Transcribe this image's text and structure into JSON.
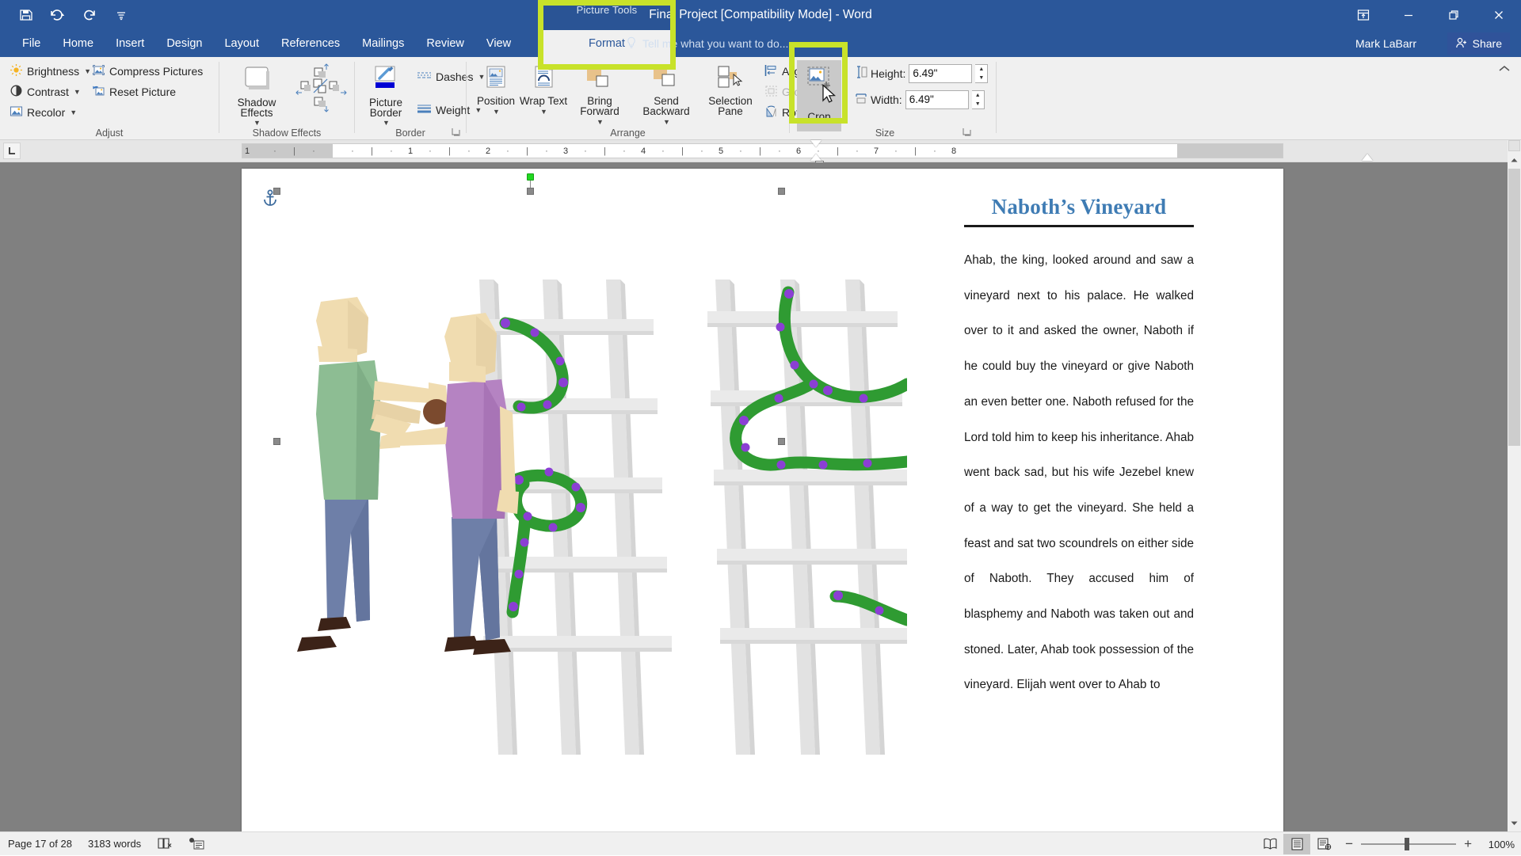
{
  "window": {
    "context_tab_label": "Picture Tools",
    "title": "Final Project [Compatibility Mode] - Word",
    "account_name": "Mark LaBarr",
    "share_label": "Share",
    "quick_access": [
      "save-icon",
      "undo-icon",
      "redo-icon",
      "customize-qat-icon"
    ],
    "window_buttons": [
      "ribbon-display-options-icon",
      "minimize-icon",
      "restore-icon",
      "close-icon"
    ]
  },
  "tabs": [
    {
      "label": "File",
      "active": false
    },
    {
      "label": "Home",
      "active": false
    },
    {
      "label": "Insert",
      "active": false
    },
    {
      "label": "Design",
      "active": false
    },
    {
      "label": "Layout",
      "active": false
    },
    {
      "label": "References",
      "active": false
    },
    {
      "label": "Mailings",
      "active": false
    },
    {
      "label": "Review",
      "active": false
    },
    {
      "label": "View",
      "active": false
    }
  ],
  "format_tab": {
    "label": "Format",
    "active": true,
    "highlighted": true
  },
  "tell_me": {
    "placeholder": "Tell me what you want to do...",
    "icon": "lightbulb-icon"
  },
  "ribbon": {
    "groups": [
      {
        "name": "Adjust",
        "label": "Adjust",
        "items": [
          {
            "label": "Brightness",
            "icon": "brightness-icon",
            "dropdown": true
          },
          {
            "label": "Contrast",
            "icon": "contrast-icon",
            "dropdown": true
          },
          {
            "label": "Recolor",
            "icon": "recolor-icon",
            "dropdown": true
          },
          {
            "label": "Compress Pictures",
            "icon": "compress-pictures-icon",
            "dropdown": false
          },
          {
            "label": "Reset Picture",
            "icon": "reset-picture-icon",
            "dropdown": false
          }
        ]
      },
      {
        "name": "Shadow Effects",
        "label": "Shadow Effects",
        "items": [
          {
            "label": "Shadow Effects",
            "icon": "shadow-effects-icon",
            "dropdown": true
          },
          {
            "label": "Nudge Shadow Up",
            "icon": "nudge-shadow-up-icon"
          },
          {
            "label": "Nudge Shadow Left",
            "icon": "nudge-shadow-left-icon"
          },
          {
            "label": "Nudge Shadow Right",
            "icon": "nudge-shadow-right-icon"
          },
          {
            "label": "Nudge Shadow Down",
            "icon": "nudge-shadow-down-icon"
          },
          {
            "label": "Shadow On Off",
            "icon": "shadow-toggle-icon"
          }
        ]
      },
      {
        "name": "Border",
        "label": "Border",
        "items": [
          {
            "label": "Picture Border",
            "icon": "picture-border-icon",
            "dropdown": true,
            "color": "#0000d4"
          },
          {
            "label": "Dashes",
            "icon": "dashes-icon",
            "dropdown": true
          },
          {
            "label": "Weight",
            "icon": "weight-icon",
            "dropdown": true
          }
        ],
        "has_dialog_launcher": true
      },
      {
        "name": "Arrange",
        "label": "Arrange",
        "items": [
          {
            "label": "Position",
            "icon": "position-icon",
            "dropdown": true
          },
          {
            "label": "Wrap Text",
            "icon": "wrap-text-icon",
            "dropdown": true
          },
          {
            "label": "Bring Forward",
            "icon": "bring-forward-icon",
            "dropdown": true
          },
          {
            "label": "Send Backward",
            "icon": "send-backward-icon",
            "dropdown": true
          },
          {
            "label": "Selection Pane",
            "icon": "selection-pane-icon",
            "dropdown": false
          },
          {
            "label": "Align",
            "icon": "align-icon",
            "dropdown": true,
            "disabled": false
          },
          {
            "label": "Group",
            "icon": "group-icon",
            "dropdown": true,
            "disabled": true
          },
          {
            "label": "Rotate",
            "icon": "rotate-icon",
            "dropdown": true,
            "disabled": false
          }
        ]
      },
      {
        "name": "Size",
        "label": "Size",
        "crop": {
          "label": "Crop",
          "icon": "crop-icon",
          "highlighted": true,
          "active": true
        },
        "height": {
          "label": "Height:",
          "value": "6.49\"",
          "icon": "shape-height-icon"
        },
        "width": {
          "label": "Width:",
          "value": "6.49\"",
          "icon": "shape-width-icon"
        },
        "has_dialog_launcher": true
      }
    ],
    "collapse_icon": "chevron-up-icon"
  },
  "ruler": {
    "tab_stop_selector": "left-tab-icon",
    "numbers": [
      "1",
      "2",
      "3",
      "4",
      "5",
      "6",
      "7",
      "8"
    ],
    "left_indent_marker": true,
    "right_indent_marker": true
  },
  "document": {
    "heading": "Naboth’s Vineyard",
    "paragraph": "Ahab, the king, looked around and saw a vineyard next to his palace. He walked over to it and asked the owner, Naboth if he could buy the vineyard or give Naboth an even better one. Naboth refused for the Lord told him to keep his inheritance. Ahab went back sad, but his wife Jezebel knew of a way to get the vineyard. She held a feast and sat two scoundrels on either side of Naboth. They accused him of blasphemy and Naboth was taken out and stoned. Later, Ahab took possession of the vineyard. Elijah went over to Ahab to",
    "illustration_alt": "Two men at a grape vine trellis",
    "selected_object": {
      "anchor_icon": "object-anchor-icon",
      "rotation_handle": "rotate-handle",
      "handles": 8
    }
  },
  "status_bar": {
    "page": "Page 17 of 28",
    "words": "3183 words",
    "proofing_icon": "proofing-errors-icon",
    "macro_icon": "macro-record-icon",
    "views": [
      {
        "name": "read-mode",
        "icon": "read-mode-icon",
        "selected": false
      },
      {
        "name": "print-layout",
        "icon": "print-layout-icon",
        "selected": true
      },
      {
        "name": "web-layout",
        "icon": "web-layout-icon",
        "selected": false
      }
    ],
    "zoom_out": "−",
    "zoom_in": "+",
    "zoom_level": "100%"
  }
}
